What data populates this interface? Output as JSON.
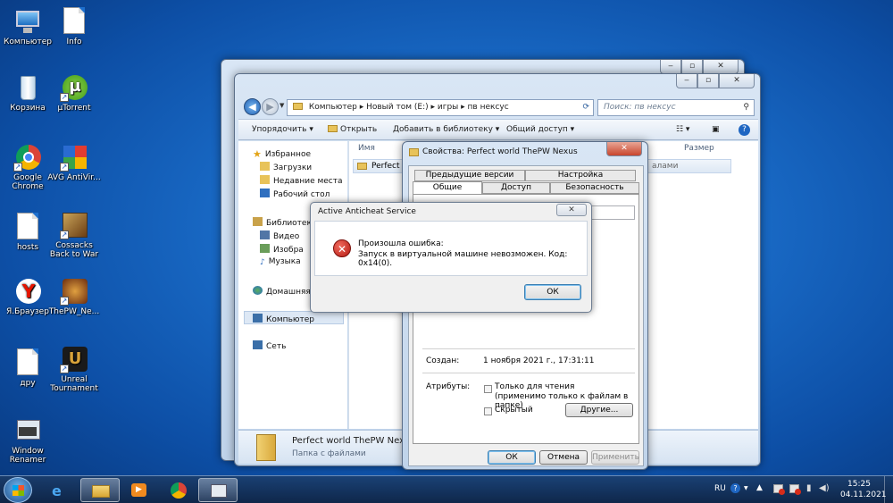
{
  "desktop_icons": [
    {
      "label": "Компьютер",
      "icon": "computer-icon"
    },
    {
      "label": "Info",
      "icon": "document-icon"
    },
    {
      "label": "Корзина",
      "icon": "recycle-bin-icon"
    },
    {
      "label": "µTorrent",
      "icon": "utorrent-icon"
    },
    {
      "label": "Google Chrome",
      "icon": "chrome-icon"
    },
    {
      "label": "AVG AntiVir...",
      "icon": "avg-icon"
    },
    {
      "label": "hosts",
      "icon": "document-icon"
    },
    {
      "label": "Cossacks Back to War",
      "icon": "cossacks-icon"
    },
    {
      "label": "Я.Браузер",
      "icon": "yandex-browser-icon"
    },
    {
      "label": "ThePW_Ne...",
      "icon": "thepw-icon"
    },
    {
      "label": "дру",
      "icon": "document-icon"
    },
    {
      "label": "Unreal Tournament",
      "icon": "unreal-icon"
    },
    {
      "label": "Window Renamer",
      "icon": "window-renamer-icon"
    }
  ],
  "explorer": {
    "breadcrumb": [
      "Компьютер",
      "Новый том (E:)",
      "игры",
      "пв нексус"
    ],
    "search_placeholder": "Поиск: пв нексус",
    "toolbar": {
      "organize": "Упорядочить",
      "open": "Открыть",
      "add_to_library": "Добавить в библиотеку",
      "share": "Общий доступ"
    },
    "columns": {
      "name": "Имя",
      "size": "Размер"
    },
    "file_row": "Perfect w",
    "nav": {
      "favorites": "Избранное",
      "downloads": "Загрузки",
      "recent": "Недавние места",
      "desktop": "Рабочий стол",
      "libraries": "Библиотеки",
      "video": "Видео",
      "images": "Изобра",
      "music": "Музыка",
      "homegroup": "Домашняя",
      "computer": "Компьютер",
      "network": "Сеть"
    },
    "details": {
      "name": "Perfect world ThePW Nexus",
      "type": "Папка с файлами"
    }
  },
  "properties": {
    "title": "Свойства: Perfect world ThePW Nexus",
    "tabs_row1": [
      "Предыдущие версии",
      "Настройка"
    ],
    "tabs_row2": [
      "Общие",
      "Доступ",
      "Безопасность"
    ],
    "created_label": "Создан:",
    "created_value": "1 ноября 2021 г., 17:31:11",
    "attributes_label": "Атрибуты:",
    "readonly": "Только для чтения",
    "readonly_note": "(применимо только к файлам в папке)",
    "hidden": "Скрытый",
    "other_button": "Другие...",
    "ok": "ОК",
    "cancel": "Отмена",
    "apply": "Применить",
    "snippet": "алами"
  },
  "error_dialog": {
    "title": "Active Anticheat Service",
    "line1": "Произошла ошибка:",
    "line2": "Запуск в виртуальной машине невозможен. Код: 0x14(0).",
    "ok": "ОК"
  },
  "tray": {
    "lang": "RU",
    "time": "15:25",
    "date": "04.11.2021"
  }
}
